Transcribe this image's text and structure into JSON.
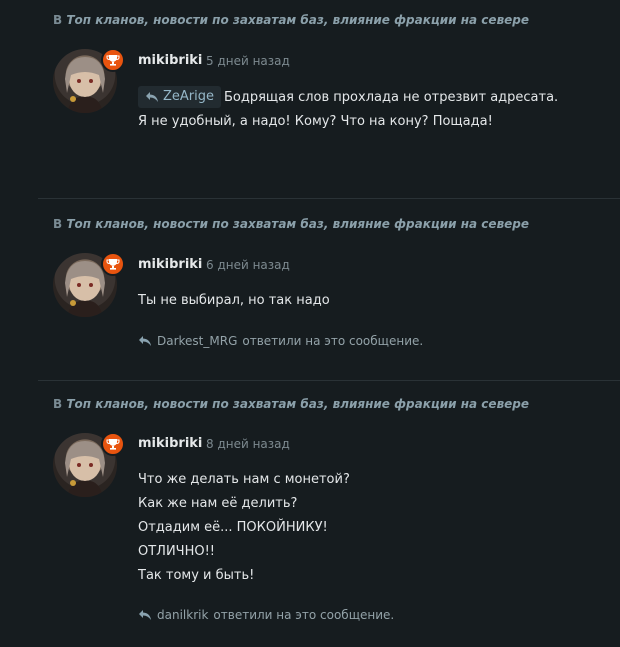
{
  "posts": [
    {
      "thread_prefix": "В",
      "thread_title": "Топ кланов, новости по захватам баз, влияние фракции на севере",
      "author": "mikibriki",
      "time": "5 дней назад",
      "quote_user": "ZeArige",
      "lines": [
        "Бодрящая слов прохлада не отрезвит адресата.",
        "Я не удобный, а надо! Кому? Что на кону? Пощада!"
      ],
      "reply_user": "",
      "reply_text": ""
    },
    {
      "thread_prefix": "В",
      "thread_title": "Топ кланов, новости по захватам баз, влияние фракции на севере",
      "author": "mikibriki",
      "time": "6 дней назад",
      "lines": [
        "Ты не выбирал, но так надо"
      ],
      "reply_user": "Darkest_MRG",
      "reply_text": "ответили на это сообщение."
    },
    {
      "thread_prefix": "В",
      "thread_title": "Топ кланов, новости по захватам баз, влияние фракции на севере",
      "author": "mikibriki",
      "time": "8 дней назад",
      "lines": [
        "Что же делать нам с монетой?",
        "Как же нам её делить?",
        "Отдадим её... ПОКОЙНИКУ!",
        "ОТЛИЧНО!!",
        "Так тому и быть!"
      ],
      "reply_user": "danilkrik",
      "reply_text": "ответили на это сообщение."
    }
  ],
  "icons": {
    "reply": "reply-arrow-icon",
    "trophy": "trophy-icon",
    "avatar": "avatar-image"
  },
  "colors": {
    "background": "#161c1f",
    "trophy_badge": "#e8540f",
    "quote_link": "#95b7c8",
    "thread_link": "#8ba0aa"
  }
}
